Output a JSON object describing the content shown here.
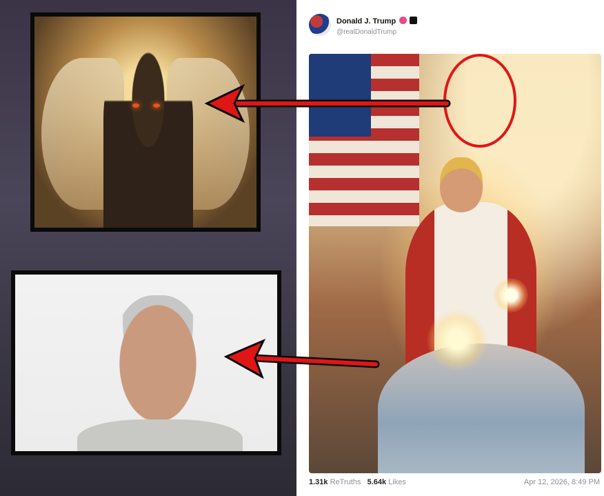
{
  "post": {
    "author_name": "Donald J. Trump",
    "author_handle": "@realDonaldTrump",
    "avatar_icon": "flag-avatar-icon",
    "verified_icon": "verified-badge-icon",
    "plus_icon": "plus-badge-icon",
    "image_alt": "",
    "stats": {
      "retruths_value": "1.31k",
      "retruths_label": "ReTruths",
      "likes_value": "5.64k",
      "likes_label": "Likes"
    },
    "timestamp": "Apr 12, 2026, 8:49 PM"
  },
  "annotations": {
    "circle_color": "#e01616",
    "arrow_color": "#e01616",
    "insets": [
      {
        "name": "demon-image-inset"
      },
      {
        "name": "portrait-photo-inset"
      }
    ]
  }
}
